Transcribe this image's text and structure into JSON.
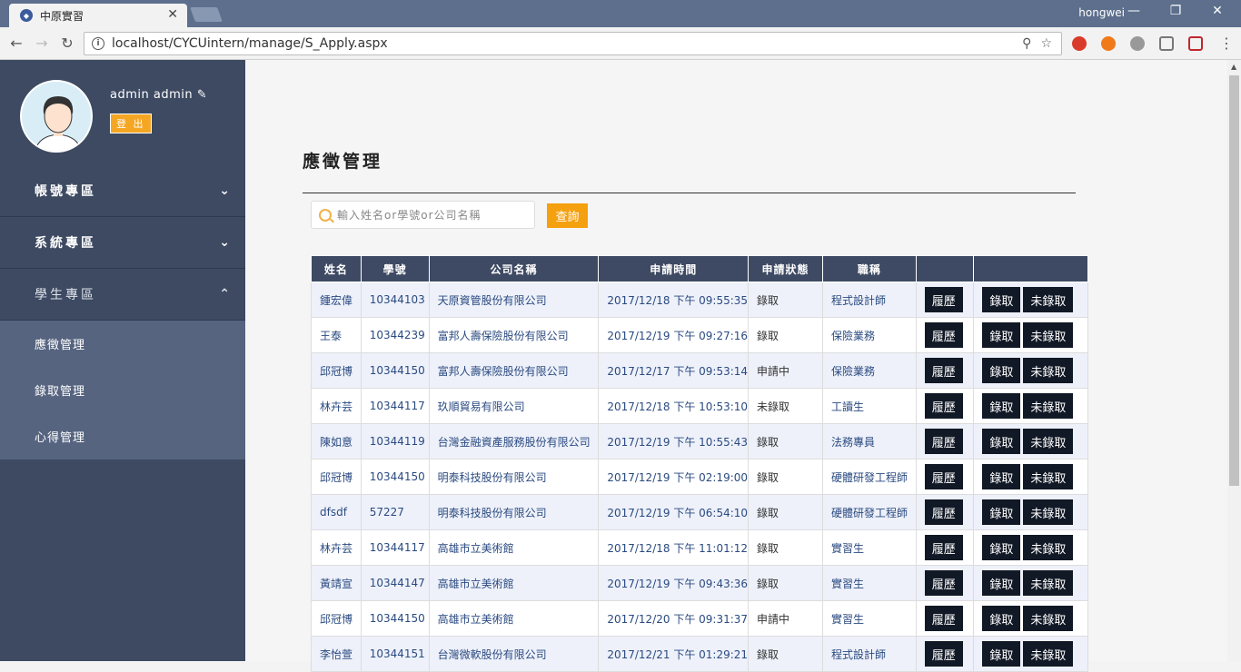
{
  "browser": {
    "tab_title": "中原實習",
    "user": "hongwei",
    "url": "localhost/CYCUintern/manage/S_Apply.aspx"
  },
  "sidebar": {
    "user_name": "admin admin",
    "logout_label": "登 出",
    "menus": [
      {
        "label": "帳號專區",
        "open": false
      },
      {
        "label": "系統專區",
        "open": false
      },
      {
        "label": "學生專區",
        "open": true
      }
    ],
    "submenu": [
      "應徵管理",
      "錄取管理",
      "心得管理"
    ]
  },
  "main": {
    "title": "應徵管理",
    "search_placeholder": "輸入姓名or學號or公司名稱",
    "query_label": "查詢",
    "headers": [
      "姓名",
      "學號",
      "公司名稱",
      "申請時間",
      "申請狀態",
      "職稱",
      "",
      ""
    ],
    "resume_label": "履歷",
    "accept_label": "錄取",
    "reject_label": "未錄取",
    "rows": [
      {
        "name": "鍾宏偉",
        "id": "10344103",
        "company": "天原資管股份有限公司",
        "time": "2017/12/18 下午 09:55:35",
        "status": "錄取",
        "title": "程式設計師"
      },
      {
        "name": "王泰",
        "id": "10344239",
        "company": "富邦人壽保險股份有限公司",
        "time": "2017/12/19 下午 09:27:16",
        "status": "錄取",
        "title": "保險業務"
      },
      {
        "name": "邱冠博",
        "id": "10344150",
        "company": "富邦人壽保險股份有限公司",
        "time": "2017/12/17 下午 09:53:14",
        "status": "申請中",
        "title": "保險業務"
      },
      {
        "name": "林卉芸",
        "id": "10344117",
        "company": "玖順貿易有限公司",
        "time": "2017/12/18 下午 10:53:10",
        "status": "未錄取",
        "title": "工讀生"
      },
      {
        "name": "陳如意",
        "id": "10344119",
        "company": "台灣金融資產服務股份有限公司",
        "time": "2017/12/19 下午 10:55:43",
        "status": "錄取",
        "title": "法務專員"
      },
      {
        "name": "邱冠博",
        "id": "10344150",
        "company": "明泰科技股份有限公司",
        "time": "2017/12/19 下午 02:19:00",
        "status": "錄取",
        "title": "硬體研發工程師"
      },
      {
        "name": "dfsdf",
        "id": "57227",
        "company": "明泰科技股份有限公司",
        "time": "2017/12/19 下午 06:54:10",
        "status": "錄取",
        "title": "硬體研發工程師"
      },
      {
        "name": "林卉芸",
        "id": "10344117",
        "company": "高雄市立美術館",
        "time": "2017/12/18 下午 11:01:12",
        "status": "錄取",
        "title": "實習生"
      },
      {
        "name": "黃靖宣",
        "id": "10344147",
        "company": "高雄市立美術館",
        "time": "2017/12/19 下午 09:43:36",
        "status": "錄取",
        "title": "實習生"
      },
      {
        "name": "邱冠博",
        "id": "10344150",
        "company": "高雄市立美術館",
        "time": "2017/12/20 下午 09:31:37",
        "status": "申請中",
        "title": "實習生"
      },
      {
        "name": "李怡萱",
        "id": "10344151",
        "company": "台灣微軟股份有限公司",
        "time": "2017/12/21 下午 01:29:21",
        "status": "錄取",
        "title": "程式設計師"
      }
    ]
  }
}
